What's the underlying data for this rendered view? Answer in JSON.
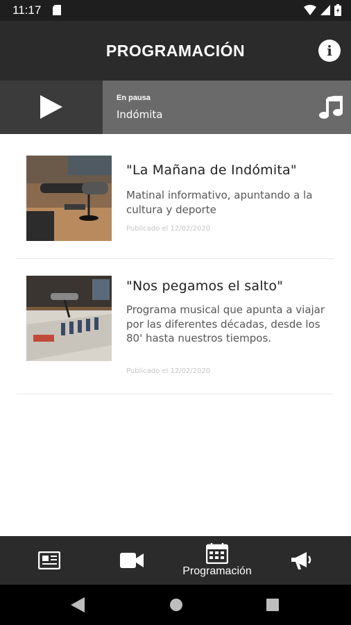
{
  "status_bar": {
    "time": "11:17"
  },
  "app_bar": {
    "title": "PROGRAMACIÓN",
    "info_glyph": "i"
  },
  "player": {
    "status": "En pausa",
    "station": "Indómita"
  },
  "programs": [
    {
      "title": "\"La Mañana de Indómita\"",
      "description": "Matinal informativo, apuntando a la cultura y deporte",
      "published": "Publicado el 12/02/2020"
    },
    {
      "title": "\"Nos pegamos el salto\"",
      "description": "Programa musical que apunta a viajar por las diferentes décadas, desde los 80' hasta nuestros tiempos.",
      "published": "Publicado el 12/02/2020"
    }
  ],
  "bottom_nav": {
    "items": [
      {
        "icon": "news-icon",
        "label": ""
      },
      {
        "icon": "video-camera-icon",
        "label": ""
      },
      {
        "icon": "calendar-icon",
        "label": "Programación",
        "active": true
      },
      {
        "icon": "megaphone-icon",
        "label": ""
      }
    ]
  },
  "colors": {
    "app_bar": "#2b2b2b",
    "player_bar": "#6a6a6a",
    "play_area": "#3b3b3b",
    "bottom_nav": "#2b2b2b",
    "status_bar": "#1e1e1e"
  }
}
